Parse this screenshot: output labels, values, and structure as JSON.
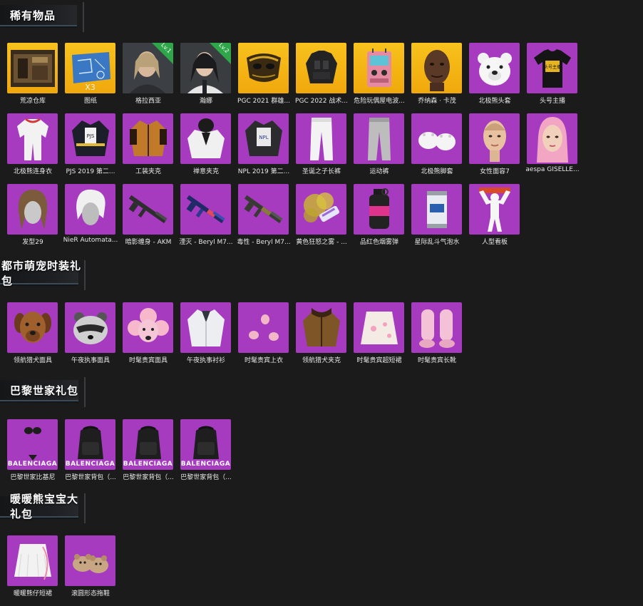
{
  "sections": [
    {
      "title": "稀有物品",
      "items": [
        {
          "label": "荒凉仓库",
          "icon": "warehouse-icon"
        },
        {
          "label": "图纸",
          "icon": "blueprint-icon",
          "count": "X3"
        },
        {
          "label": "格拉西亚",
          "icon": "character-portrait-icon",
          "level": "Lv.1"
        },
        {
          "label": "瀚娜",
          "icon": "character-portrait-icon",
          "level": "Lv.2"
        },
        {
          "label": "PGC 2021 群雄...",
          "icon": "mask-icon"
        },
        {
          "label": "PGC 2022 战术...",
          "icon": "tactical-vest-icon"
        },
        {
          "label": "危险玩偶屋电波...",
          "icon": "radio-backpack-icon"
        },
        {
          "label": "乔纳森 · 卡茂",
          "icon": "face-icon"
        },
        {
          "label": "北极熊头套",
          "icon": "polar-bear-mask-icon"
        },
        {
          "label": "头号主播",
          "icon": "tshirt-icon",
          "shirt_text": "头号主播"
        },
        {
          "label": "北极熊连身衣",
          "icon": "jumpsuit-icon"
        },
        {
          "label": "PJS 2019 第二...",
          "icon": "jacket-icon",
          "jacket_text": "PJS"
        },
        {
          "label": "工装夹克",
          "icon": "jacket-icon"
        },
        {
          "label": "禅意夹克",
          "icon": "hoodie-icon"
        },
        {
          "label": "NPL 2019 第二...",
          "icon": "jacket-icon",
          "jacket_text": "NPL"
        },
        {
          "label": "圣诞之子长裤",
          "icon": "pants-icon"
        },
        {
          "label": "运动裤",
          "icon": "pants-icon"
        },
        {
          "label": "北极熊脚套",
          "icon": "paw-shoes-icon"
        },
        {
          "label": "女性面容7",
          "icon": "face-icon"
        },
        {
          "label": "aespa GISELLE...",
          "icon": "face-icon"
        },
        {
          "label": "发型29",
          "icon": "hair-icon"
        },
        {
          "label": "NieR Automata...",
          "icon": "hair-icon"
        },
        {
          "label": "暗影缠身 - AKM",
          "icon": "rifle-icon"
        },
        {
          "label": "湮灭 - Beryl M7...",
          "icon": "rifle-icon"
        },
        {
          "label": "毒性 - Beryl M7...",
          "icon": "rifle-icon"
        },
        {
          "label": "黄色狂怒之雾 - ...",
          "icon": "smoke-icon"
        },
        {
          "label": "品红色烟雾弹",
          "icon": "grenade-icon"
        },
        {
          "label": "星际乱斗气泡水",
          "icon": "soda-can-icon"
        },
        {
          "label": "人型看板",
          "icon": "human-figure-icon"
        }
      ]
    },
    {
      "title": "都市萌宠时装礼包",
      "items": [
        {
          "label": "领航猎犬面具",
          "icon": "dog-mask-icon"
        },
        {
          "label": "午夜执事面具",
          "icon": "raccoon-mask-icon"
        },
        {
          "label": "时髦贵宾面具",
          "icon": "poodle-mask-icon"
        },
        {
          "label": "午夜执事衬衫",
          "icon": "shirt-icon"
        },
        {
          "label": "时髦贵宾上衣",
          "icon": "top-icon"
        },
        {
          "label": "领航猎犬夹克",
          "icon": "jacket-icon"
        },
        {
          "label": "时髦贵宾超短裙",
          "icon": "skirt-icon"
        },
        {
          "label": "时髦贵宾长靴",
          "icon": "boots-icon"
        }
      ]
    },
    {
      "title": "巴黎世家礼包",
      "items": [
        {
          "label": "巴黎世家比基尼",
          "icon": "bikini-icon",
          "brand": "BALENCIAGA"
        },
        {
          "label": "巴黎世家背包（...",
          "icon": "backpack-icon",
          "brand": "BALENCIAGA"
        },
        {
          "label": "巴黎世家背包（...",
          "icon": "backpack-icon",
          "brand": "BALENCIAGA"
        },
        {
          "label": "巴黎世家背包（...",
          "icon": "backpack-icon",
          "brand": "BALENCIAGA"
        }
      ]
    },
    {
      "title": "暖暖熊宝宝大礼包",
      "items": [
        {
          "label": "暖暖熊仔短裙",
          "icon": "skirt-icon"
        },
        {
          "label": "滚圆形态拖鞋",
          "icon": "slippers-icon"
        }
      ]
    }
  ],
  "colors": {
    "background": "#1b1b1c",
    "tile_purple": "#a63bc0",
    "tile_gold": "#f5b814",
    "level_tag": "#2fa64a"
  }
}
